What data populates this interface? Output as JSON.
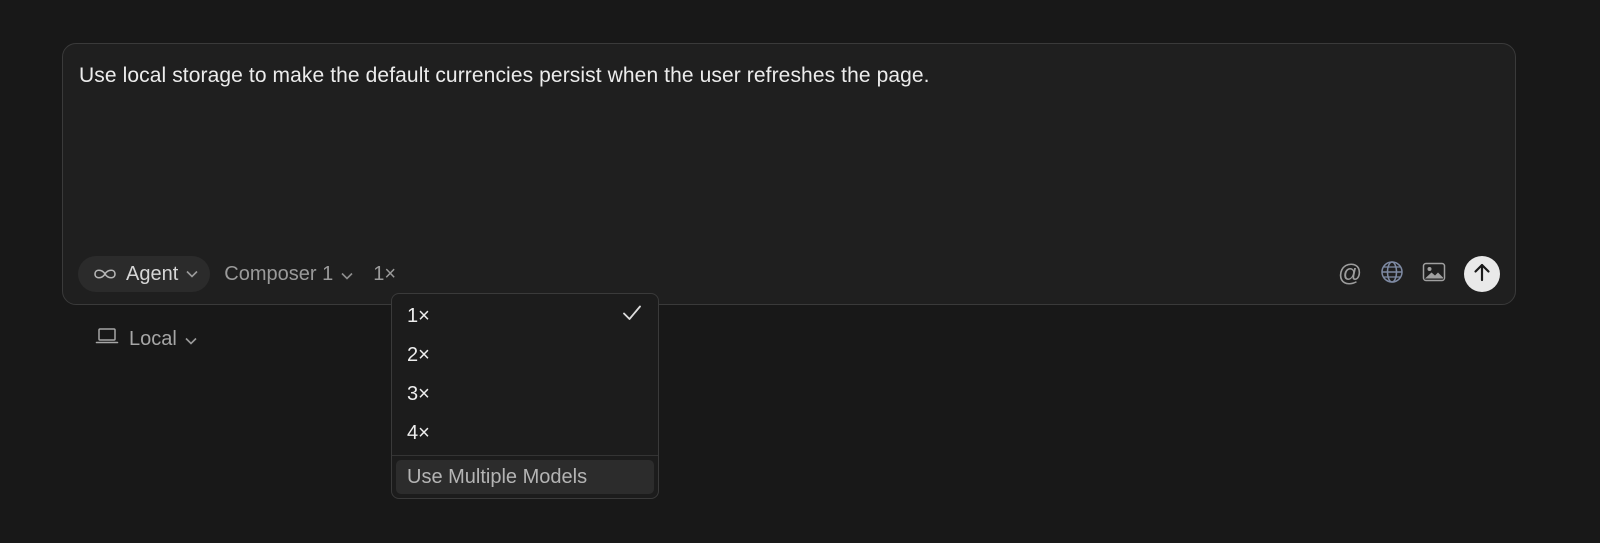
{
  "composer": {
    "prompt_text": "Use local storage to make the default currencies persist when the user refreshes the page.",
    "mode": {
      "label": "Agent",
      "icon": "infinity-icon"
    },
    "model": {
      "label": "Composer 1"
    },
    "multiplier": {
      "label": "1×"
    },
    "actions": {
      "mention_icon": "at-icon",
      "web_icon": "globe-icon",
      "image_icon": "image-icon",
      "send_icon": "arrow-up-icon"
    }
  },
  "environment": {
    "label": "Local",
    "icon": "laptop-icon"
  },
  "multiplier_menu": {
    "options": [
      {
        "label": "1×",
        "selected": true
      },
      {
        "label": "2×",
        "selected": false
      },
      {
        "label": "3×",
        "selected": false
      },
      {
        "label": "4×",
        "selected": false
      }
    ],
    "footer_action": "Use Multiple Models"
  },
  "colors": {
    "background": "#181818",
    "composer_bg": "#1f1f1f",
    "border": "#3a3a3a",
    "send_button": "#e9e9e9"
  }
}
